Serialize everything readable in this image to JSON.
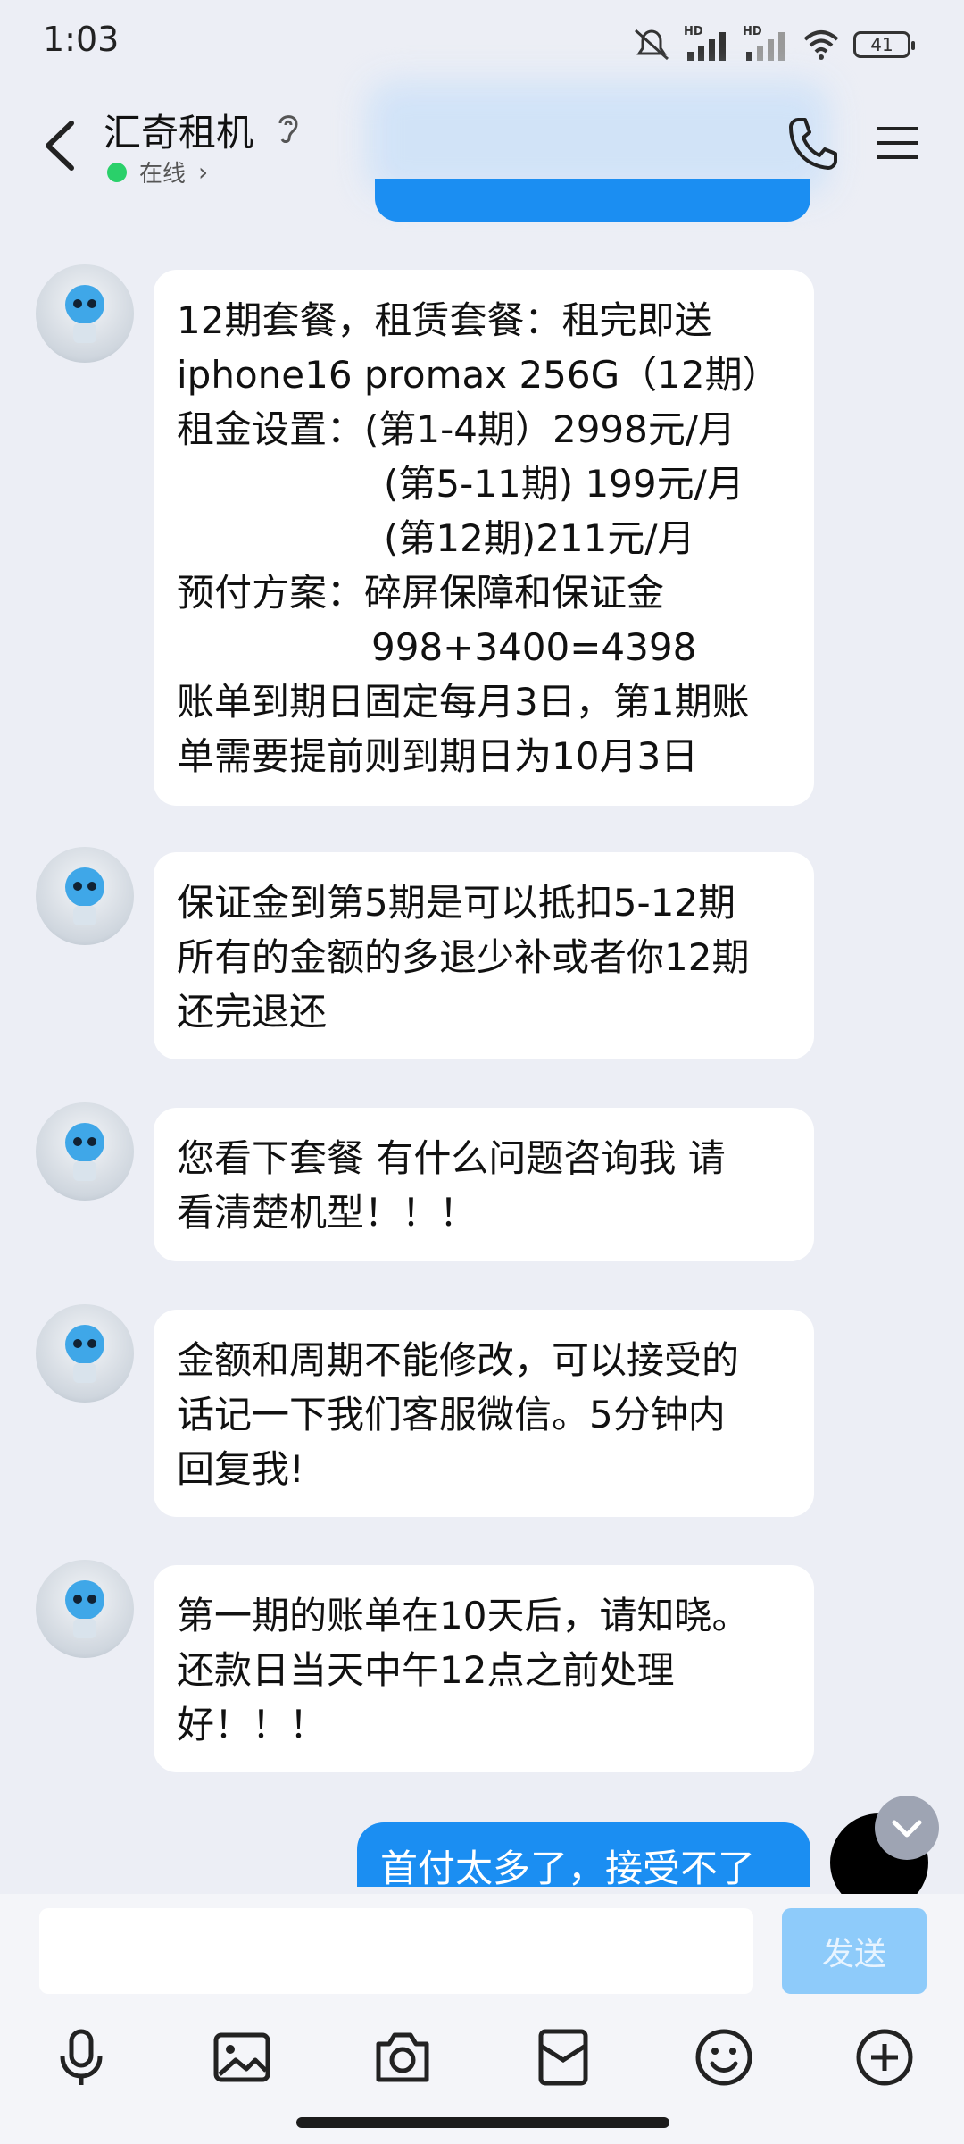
{
  "status_bar": {
    "time": "1:03",
    "hd1": "HD",
    "hd2": "HD",
    "battery": "41"
  },
  "header": {
    "contact_name": "汇奇租机",
    "status": "在线",
    "status_color": "#2ad06a"
  },
  "messages": [
    {
      "lines": [
        "12期套餐，租赁套餐：租完即送",
        "iphone16 promax 256G（12期）",
        "租金设置：(第1-4期）2998元/月",
        "(第5-11期) 199元/月",
        "(第12期)211元/月",
        "预付方案：碎屏保障和保证金",
        "998+3400=4398",
        "账单到期日固定每月3日，第1期账",
        "单需要提前则到期日为10月3日"
      ]
    },
    {
      "lines": [
        "保证金到第5期是可以抵扣5-12期",
        "所有的金额的多退少补或者你12期",
        "还完退还"
      ]
    },
    {
      "lines": [
        "您看下套餐 有什么问题咨询我 请",
        "看清楚机型！！！"
      ]
    },
    {
      "lines": [
        "金额和周期不能修改，可以接受的",
        "话记一下我们客服微信。5分钟内",
        "回复我!"
      ]
    },
    {
      "lines": [
        "第一期的账单在10天后，请知晓。",
        "还款日当天中午12点之前处理",
        "好！！！"
      ]
    }
  ],
  "sent_message": "首付太多了，接受不了",
  "composer": {
    "send_label": "发送",
    "accent": "#1b8ef2"
  },
  "toolbar_icons": [
    "microphone-icon",
    "image-icon",
    "camera-icon",
    "red-packet-icon",
    "emoji-icon",
    "plus-icon"
  ]
}
